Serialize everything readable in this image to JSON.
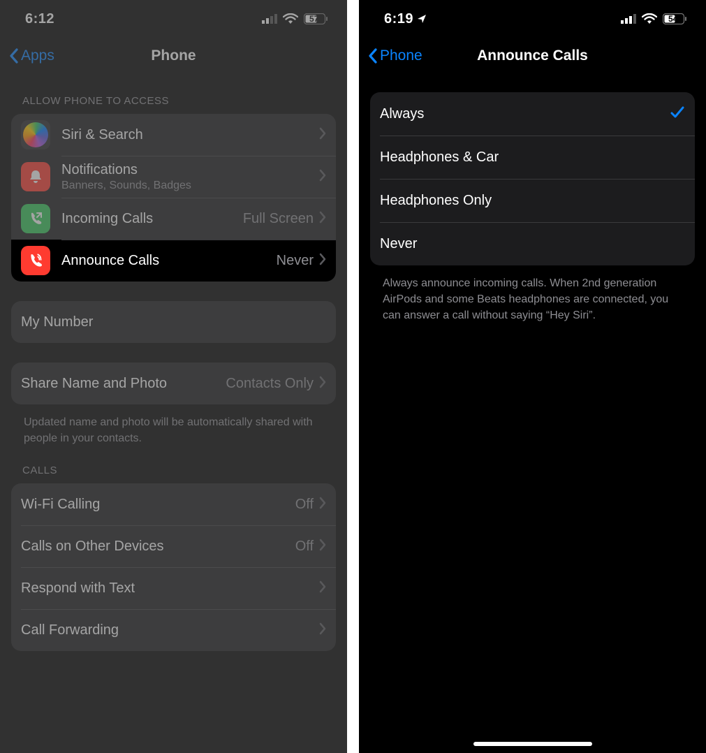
{
  "left": {
    "status": {
      "time": "6:12",
      "battery": "57"
    },
    "nav": {
      "back": "Apps",
      "title": "Phone"
    },
    "section_access_header": "ALLOW PHONE TO ACCESS",
    "rows_access": {
      "siri": {
        "label": "Siri & Search"
      },
      "notifications": {
        "label": "Notifications",
        "sub": "Banners, Sounds, Badges"
      },
      "incoming": {
        "label": "Incoming Calls",
        "value": "Full Screen"
      },
      "announce": {
        "label": "Announce Calls",
        "value": "Never"
      }
    },
    "my_number": {
      "label": "My Number"
    },
    "share": {
      "label": "Share Name and Photo",
      "value": "Contacts Only"
    },
    "share_footer": "Updated name and photo will be automatically shared with people in your contacts.",
    "section_calls_header": "CALLS",
    "rows_calls": {
      "wifi": {
        "label": "Wi-Fi Calling",
        "value": "Off"
      },
      "other": {
        "label": "Calls on Other Devices",
        "value": "Off"
      },
      "respond": {
        "label": "Respond with Text"
      },
      "forward": {
        "label": "Call Forwarding"
      }
    }
  },
  "right": {
    "status": {
      "time": "6:19",
      "battery": "54"
    },
    "nav": {
      "back": "Phone",
      "title": "Announce Calls"
    },
    "options": {
      "always": "Always",
      "hp_car": "Headphones & Car",
      "hp_only": "Headphones Only",
      "never": "Never"
    },
    "selected": "always",
    "footer": "Always announce incoming calls. When 2nd generation AirPods and some Beats headphones are connected, you can answer a call without saying “Hey Siri”."
  }
}
